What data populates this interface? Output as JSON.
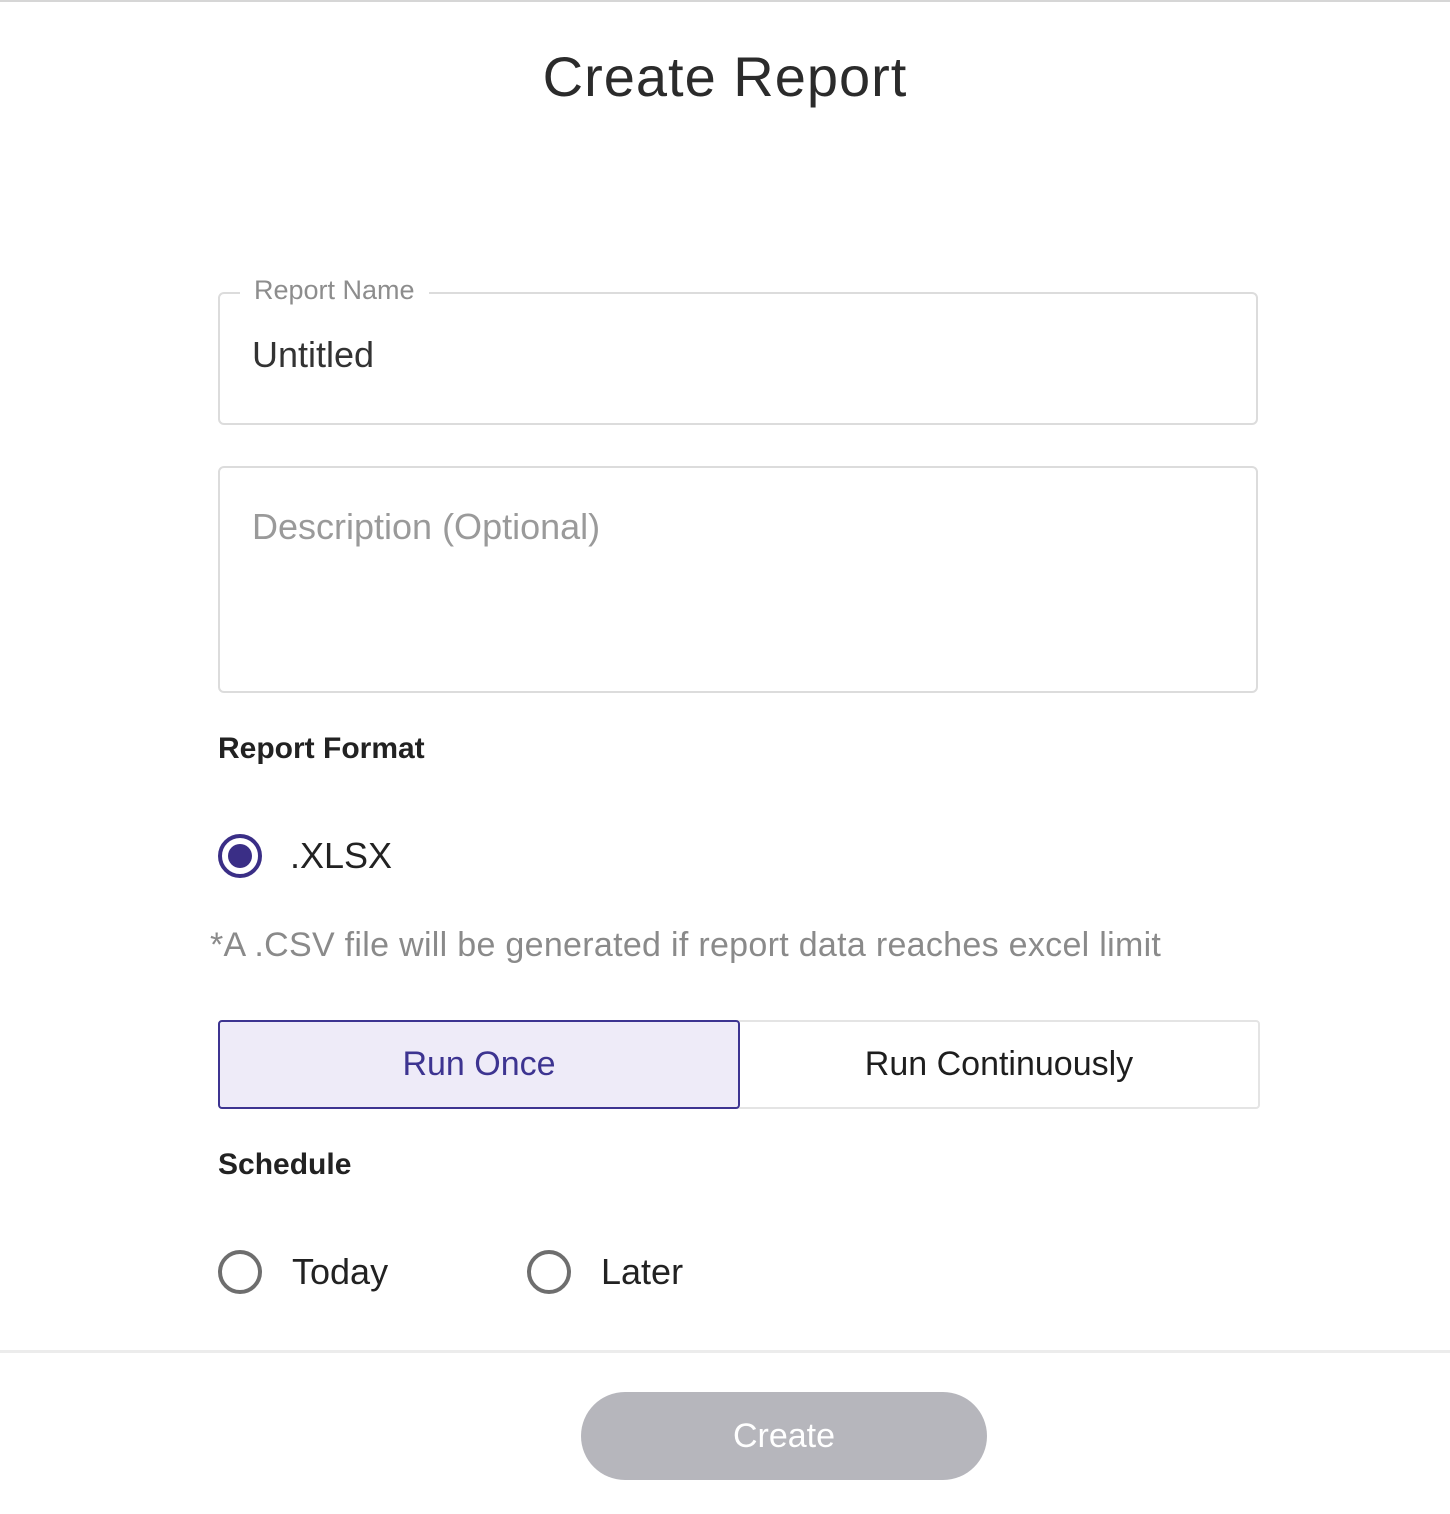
{
  "dialog": {
    "title": "Create Report"
  },
  "report_name": {
    "label": "Report Name",
    "value": "Untitled"
  },
  "description": {
    "placeholder": "Description (Optional)",
    "value": ""
  },
  "report_format": {
    "heading": "Report Format",
    "options": [
      {
        "label": ".XLSX",
        "selected": true
      }
    ],
    "note": "*A .CSV file will be generated if report data reaches excel limit"
  },
  "run_mode": {
    "options": [
      {
        "label": "Run Once",
        "selected": true
      },
      {
        "label": "Run Continuously",
        "selected": false
      }
    ]
  },
  "schedule": {
    "heading": "Schedule",
    "options": [
      {
        "label": "Today",
        "selected": false
      },
      {
        "label": "Later",
        "selected": false
      }
    ]
  },
  "actions": {
    "create_label": "Create",
    "create_enabled": false
  },
  "colors": {
    "accent": "#3a2e86",
    "segment_active_bg": "#eeebf8",
    "disabled_button": "#b6b6bc"
  }
}
